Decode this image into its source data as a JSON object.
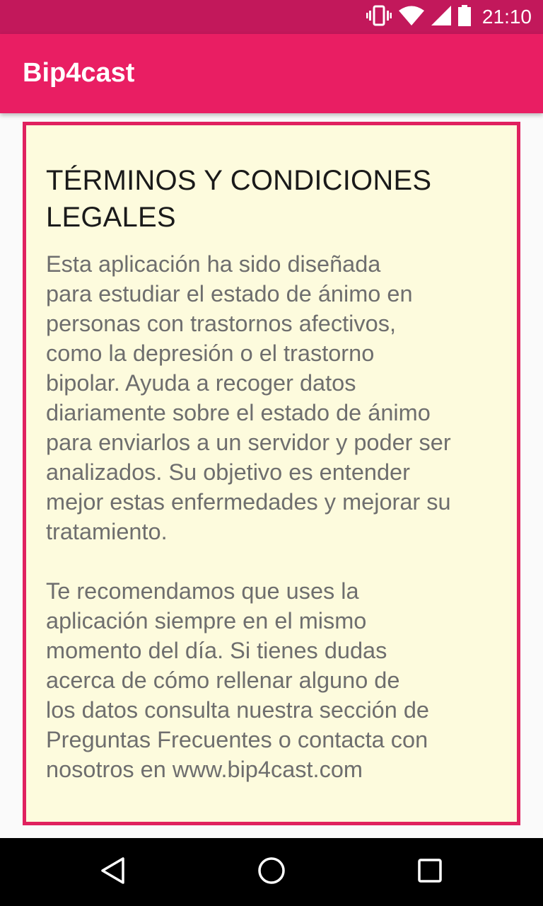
{
  "status_bar": {
    "time": "21:10",
    "icons": [
      "vibrate-icon",
      "wifi-icon",
      "cell-signal-icon",
      "battery-icon"
    ]
  },
  "app_bar": {
    "title": "Bip4cast"
  },
  "terms": {
    "title": "TÉRMINOS Y CONDICIONES LEGALES",
    "paragraph_1": "Esta aplicación ha sido diseñada\npara estudiar el estado de ánimo en\npersonas con trastornos afectivos,\ncomo la depresión o el trastorno\nbipolar. Ayuda a recoger datos\ndiariamente sobre el estado de ánimo\npara enviarlos a un servidor y poder ser\nanalizados. Su objetivo es entender\nmejor estas enfermedades y mejorar su\ntratamiento.",
    "paragraph_2": "Te recomendamos que uses la\naplicación siempre en el mismo\nmomento del día. Si tienes dudas\nacerca de cómo rellenar alguno de\nlos datos consulta nuestra sección de\nPreguntas Frecuentes o contacta con\nnosotros en www.bip4cast.com"
  },
  "nav_bar": {
    "buttons": [
      "back-icon",
      "home-icon",
      "recents-icon"
    ]
  },
  "colors": {
    "status_bar": "#c2185b",
    "app_bar": "#e91e63",
    "card_background": "#fdfbdd",
    "card_border": "#e0215f",
    "body_text": "#6e6e6e",
    "title_text": "#1a1a1a"
  }
}
